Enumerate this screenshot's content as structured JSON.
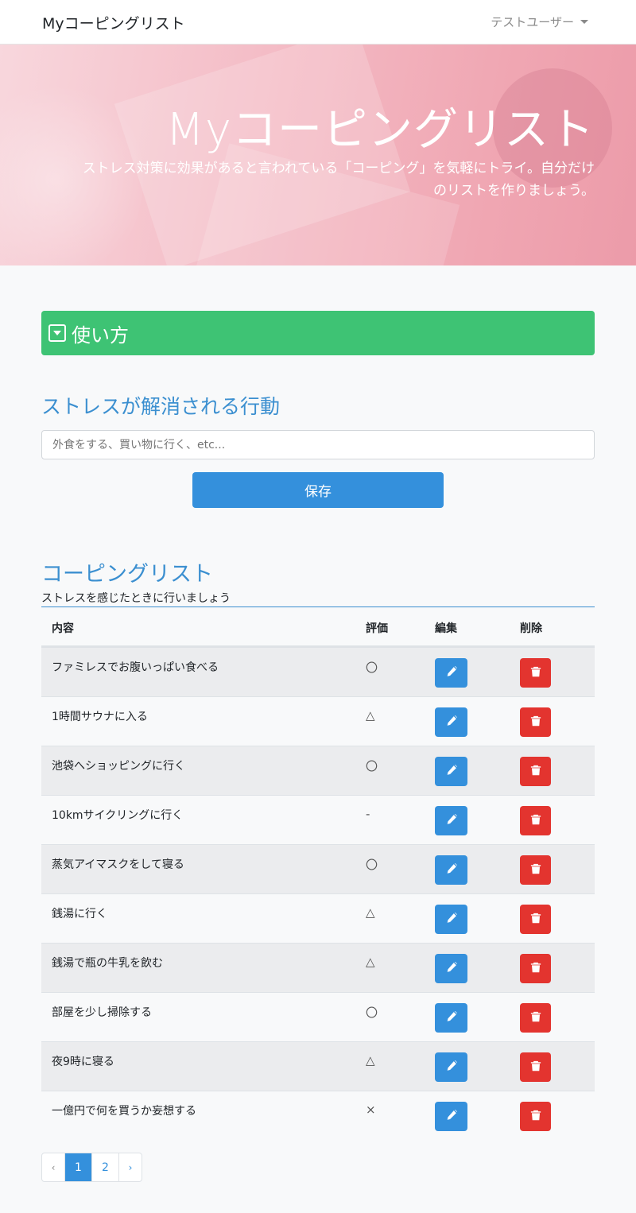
{
  "navbar": {
    "brand": "Myコーピングリスト",
    "user": "テストユーザー"
  },
  "hero": {
    "title": "Myコーピングリスト",
    "subtitle_line1": "ストレス対策に効果があると言われている「コーピング」を気軽にトライ。自分だけ",
    "subtitle_line2": "のリストを作りましょう。"
  },
  "howto": {
    "label": "使い方",
    "icon": "caret-square-down-icon"
  },
  "form": {
    "heading": "ストレスが解消される行動",
    "placeholder": "外食をする、買い物に行く、etc...",
    "save_label": "保存"
  },
  "list": {
    "heading": "コーピングリスト",
    "subheading": "ストレスを感じたときに行いましょう",
    "columns": {
      "content": "内容",
      "rating": "評価",
      "edit": "編集",
      "delete": "削除"
    },
    "rows": [
      {
        "content": "ファミレスでお腹いっぱい食べる",
        "rating": "〇"
      },
      {
        "content": "1時間サウナに入る",
        "rating": "△"
      },
      {
        "content": "池袋へショッピングに行く",
        "rating": "〇"
      },
      {
        "content": "10kmサイクリングに行く",
        "rating": "-"
      },
      {
        "content": "蒸気アイマスクをして寝る",
        "rating": "〇"
      },
      {
        "content": "銭湯に行く",
        "rating": "△"
      },
      {
        "content": "銭湯で瓶の牛乳を飲む",
        "rating": "△"
      },
      {
        "content": "部屋を少し掃除する",
        "rating": "〇"
      },
      {
        "content": "夜9時に寝る",
        "rating": "△"
      },
      {
        "content": "一億円で何を買うか妄想する",
        "rating": "×"
      }
    ]
  },
  "pagination": {
    "prev": "‹",
    "pages": [
      "1",
      "2"
    ],
    "active_page": "1",
    "next": "›"
  },
  "colors": {
    "primary": "#3490dc",
    "danger": "#e3342f",
    "success": "#3ec374",
    "heading": "#3b8fd0"
  }
}
